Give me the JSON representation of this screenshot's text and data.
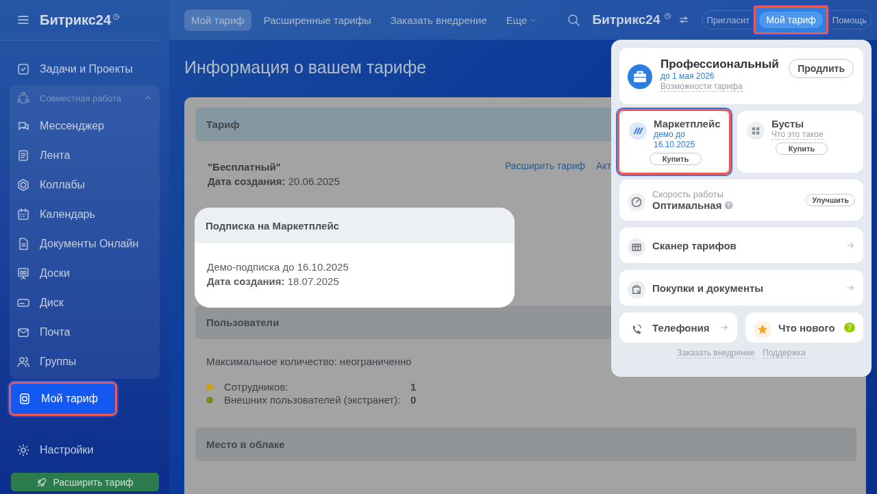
{
  "sidebar": {
    "logo": "Битрикс24",
    "items": [
      {
        "kind": "item",
        "label": "Задачи и Проекты",
        "selected": false,
        "highlighted": false
      },
      {
        "kind": "group",
        "label": "Совместная работа",
        "expanded": true,
        "children": [
          {
            "label": "Мессенджер"
          },
          {
            "label": "Лента"
          },
          {
            "label": "Коллабы"
          },
          {
            "label": "Календарь"
          },
          {
            "label": "Документы Онлайн"
          },
          {
            "label": "Доски"
          },
          {
            "label": "Диск"
          },
          {
            "label": "Почта"
          },
          {
            "label": "Группы"
          }
        ]
      },
      {
        "kind": "item",
        "label": "Мой тариф",
        "selected": true,
        "highlighted": true
      },
      {
        "kind": "item",
        "label": "Настройки",
        "selected": false,
        "highlighted": false
      }
    ],
    "upgrade_button": "Расширить тариф"
  },
  "topbar": {
    "tabs": [
      {
        "label": "Мой тариф",
        "selected": true,
        "dropdown": false
      },
      {
        "label": "Расширенные тарифы",
        "selected": false,
        "dropdown": false
      },
      {
        "label": "Заказать внедрение",
        "selected": false,
        "dropdown": false
      },
      {
        "label": "Еще",
        "selected": false,
        "dropdown": true
      }
    ],
    "logo": "Битрикс24",
    "buttons": [
      {
        "label": "Пригласит",
        "highlighted": false
      },
      {
        "label": "Мой тариф",
        "highlighted": true
      },
      {
        "label": "Помощь",
        "highlighted": false
      }
    ]
  },
  "page": {
    "title": "Информация о вашем тарифе",
    "tariff": {
      "header": "Тариф",
      "name": "\"Бесплатный\"",
      "created": "**Дата создания:** 20.06.2025",
      "links": [
        "Расширить тариф",
        "Акт"
      ]
    },
    "marketplace": {
      "header": "Подписка на Маркетплейс",
      "text": "Демо-подписка до 16.10.2025",
      "created": "**Дата создания:** 18.07.2025"
    },
    "users": {
      "header": "Пользователи",
      "max": "Максимальное количество: неограниченно",
      "rows": [
        {
          "label": "Сотрудников:",
          "value": "1",
          "color": "#c9a20c"
        },
        {
          "label": "Внешних пользователей (экстранет):",
          "value": "0",
          "color": "#6f8f1c"
        }
      ]
    },
    "cloud": {
      "header": "Место в облаке"
    }
  },
  "popup": {
    "plan": {
      "title": "Профессиональный",
      "until": "до 1 мая 2026",
      "link": "Возможности тарифа",
      "button": "Продлить"
    },
    "tiles": [
      {
        "title": "Маркетплейс",
        "subtitle": "демо до 16.10.2025",
        "button": "Купить",
        "highlighted": true
      },
      {
        "title": "Бусты",
        "link": "Что это такое",
        "button": "Купить",
        "highlighted": false
      }
    ],
    "speed": {
      "label": "Скорость работы",
      "value": "Оптимальная",
      "button": "Улучшить"
    },
    "rows": [
      {
        "label": "Сканер тарифов"
      },
      {
        "label": "Покупки и документы"
      }
    ],
    "half_rows": [
      {
        "label": "Телефония"
      },
      {
        "label": "Что нового",
        "badge": "7"
      }
    ],
    "footer_links": [
      "Заказать внедрение",
      "Поддержка"
    ]
  }
}
